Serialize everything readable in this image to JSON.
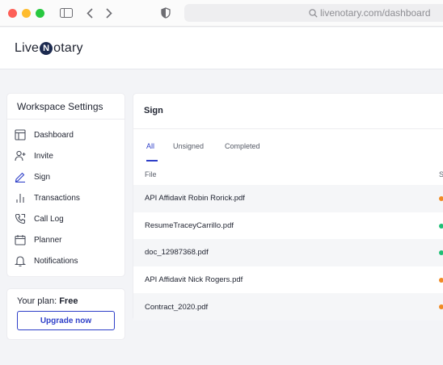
{
  "browser": {
    "url": "livenotary.com/dashboard"
  },
  "header": {
    "logo_left": "Live",
    "logo_n": "N",
    "logo_right": "otary"
  },
  "sidebar": {
    "title": "Workspace Settings",
    "items": [
      {
        "label": "Dashboard",
        "icon": "layout-icon"
      },
      {
        "label": "Invite",
        "icon": "add-user-icon"
      },
      {
        "label": "Sign",
        "icon": "pen-icon"
      },
      {
        "label": "Transactions",
        "icon": "bar-chart-icon"
      },
      {
        "label": "Call Log",
        "icon": "phone-icon"
      },
      {
        "label": "Planner",
        "icon": "calendar-icon"
      },
      {
        "label": "Notifications",
        "icon": "bell-icon"
      }
    ],
    "active_item": "Sign"
  },
  "plan": {
    "prefix": "Your plan: ",
    "name": "Free",
    "button_label": "Upgrade now"
  },
  "main": {
    "title": "Sign",
    "tabs": [
      {
        "label": "All",
        "active": true
      },
      {
        "label": "Unsigned",
        "active": false
      },
      {
        "label": "Completed",
        "active": false
      }
    ],
    "columns": {
      "file": "File",
      "status": "S"
    },
    "files": [
      {
        "name": "API Affidavit Robin Rorick.pdf",
        "status_color": "#f08a24"
      },
      {
        "name": "ResumeTraceyCarrillo.pdf",
        "status_color": "#1fbf75"
      },
      {
        "name": "doc_12987368.pdf",
        "status_color": "#1fbf75"
      },
      {
        "name": "API Affidavit Nick Rogers.pdf",
        "status_color": "#f08a24"
      },
      {
        "name": "Contract_2020.pdf",
        "status_color": "#f08a24"
      }
    ]
  },
  "colors": {
    "accent": "#2e3fc8",
    "pending": "#f08a24",
    "complete": "#1fbf75"
  }
}
